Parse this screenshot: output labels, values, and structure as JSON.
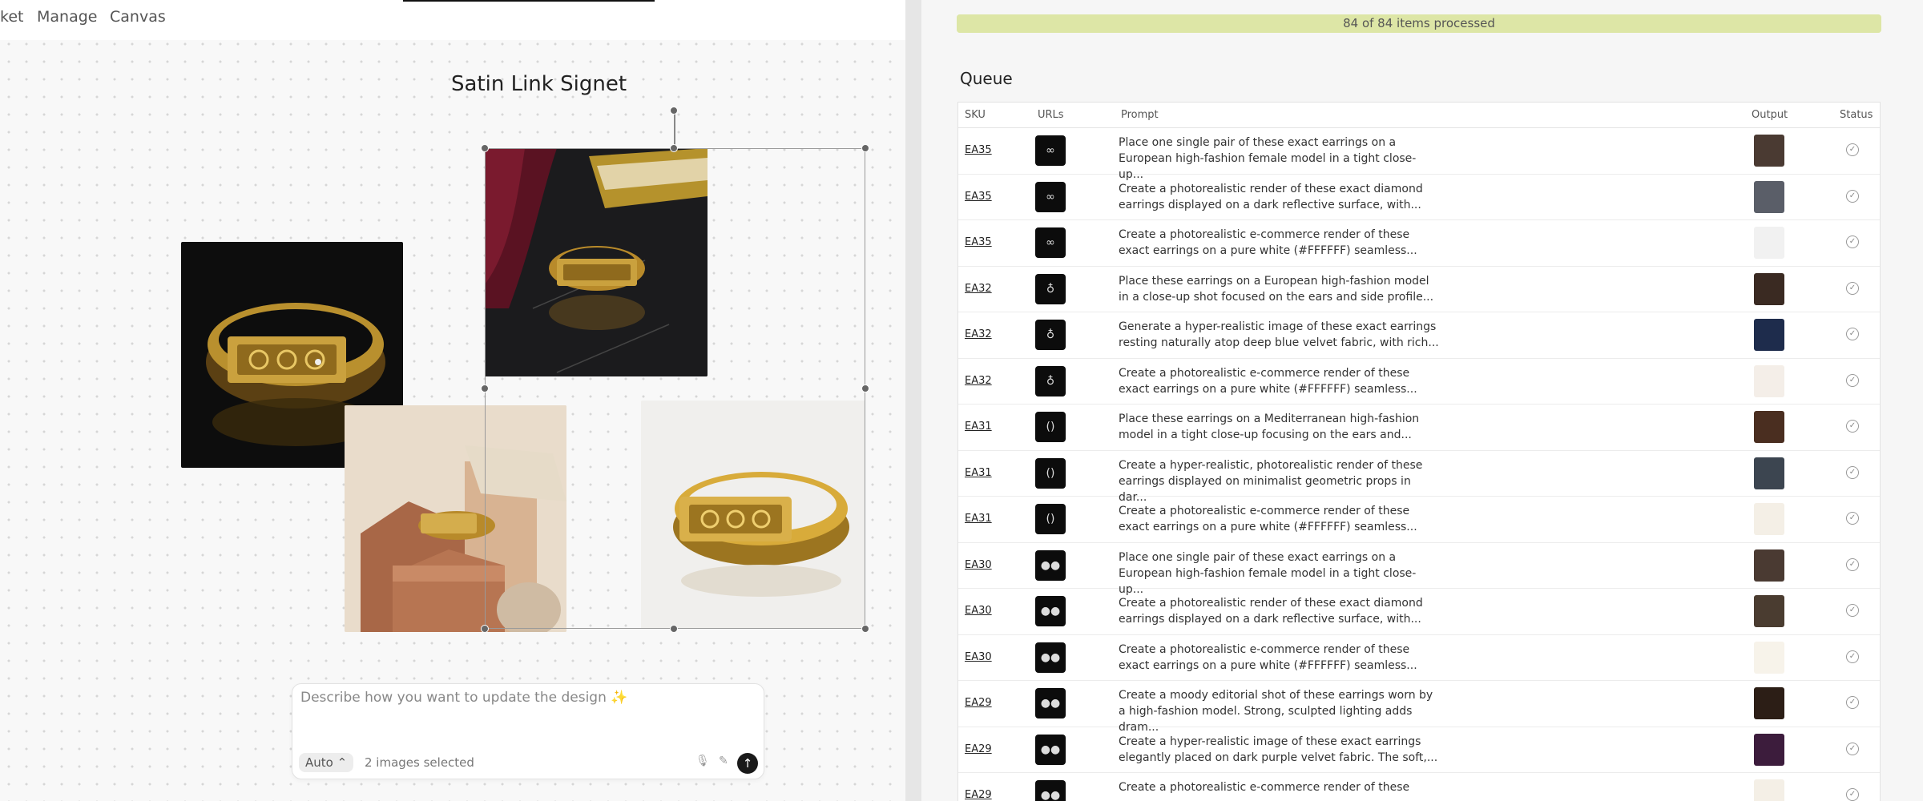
{
  "nav": {
    "items": [
      "ket",
      "Manage",
      "Canvas"
    ]
  },
  "canvas": {
    "title": "Satin Link Signet"
  },
  "prompt": {
    "placeholder": "Describe how you want to update the design ✨",
    "mode": "Auto",
    "selection": "2 images selected"
  },
  "queue": {
    "progress_text": "84 of 84 items processed",
    "progress_fraction": 1.0,
    "title": "Queue",
    "headers": {
      "sku": "SKU",
      "urls": "URLs",
      "prompt": "Prompt",
      "output": "Output",
      "status": "Status"
    },
    "rows": [
      {
        "sku": "EA35",
        "prompt": "Place one single pair of these exact earrings on a European high-fashion female model in a tight close-up...",
        "icon": "∞",
        "out": "#4a3a32"
      },
      {
        "sku": "EA35",
        "prompt": "Create a photorealistic render of these exact diamond earrings displayed on a dark reflective surface, with...",
        "icon": "∞",
        "out": "#5a5e68"
      },
      {
        "sku": "EA35",
        "prompt": "Create a photorealistic e-commerce render of these exact earrings on a pure white (#FFFFFF) seamless...",
        "icon": "∞",
        "out": "#f1f1f1"
      },
      {
        "sku": "EA32",
        "prompt": "Place these earrings on a European high-fashion model in a close-up shot focused on the ears and side profile...",
        "icon": "♁",
        "out": "#3a2a22"
      },
      {
        "sku": "EA32",
        "prompt": "Generate a hyper-realistic image of these exact earrings resting naturally atop deep blue velvet fabric, with rich...",
        "icon": "♁",
        "out": "#1e2c4c"
      },
      {
        "sku": "EA32",
        "prompt": "Create a photorealistic e-commerce render of these exact earrings on a pure white (#FFFFFF) seamless...",
        "icon": "♁",
        "out": "#f4eee8"
      },
      {
        "sku": "EA31",
        "prompt": "Place these earrings on a Mediterranean high-fashion model in a tight close-up focusing on the ears and...",
        "icon": "()",
        "out": "#4a2e20"
      },
      {
        "sku": "EA31",
        "prompt": "Create a hyper-realistic, photorealistic render of these earrings displayed on minimalist geometric props in dar...",
        "icon": "()",
        "out": "#3c4550"
      },
      {
        "sku": "EA31",
        "prompt": "Create a photorealistic e-commerce render of these exact earrings on a pure white (#FFFFFF) seamless...",
        "icon": "()",
        "out": "#f4efe6"
      },
      {
        "sku": "EA30",
        "prompt": "Place one single pair of these exact earrings on a European high-fashion female model in a tight close-up...",
        "icon": "●●",
        "out": "#4a3a32"
      },
      {
        "sku": "EA30",
        "prompt": "Create a photorealistic render of these exact diamond earrings displayed on a dark reflective surface, with...",
        "icon": "●●",
        "out": "#4a3c30"
      },
      {
        "sku": "EA30",
        "prompt": "Create a photorealistic e-commerce render of these exact earrings on a pure white (#FFFFFF) seamless...",
        "icon": "●●",
        "out": "#f7f3ea"
      },
      {
        "sku": "EA29",
        "prompt": "Create a moody editorial shot of these earrings worn by a high-fashion model. Strong, sculpted lighting adds dram...",
        "icon": "●●",
        "out": "#2c1e16"
      },
      {
        "sku": "EA29",
        "prompt": "Create a hyper-realistic image of these exact earrings elegantly placed on dark purple velvet fabric. The soft,...",
        "icon": "●●",
        "out": "#3c1c3c"
      },
      {
        "sku": "EA29",
        "prompt": "Create a photorealistic e-commerce render of these",
        "icon": "●●",
        "out": "#f4efe6"
      }
    ]
  }
}
